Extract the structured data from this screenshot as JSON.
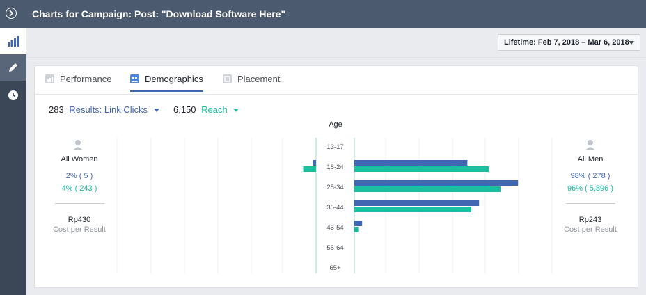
{
  "header": {
    "title": "Charts for Campaign: Post: \"Download Software Here\""
  },
  "sidebar": {
    "items": [
      {
        "icon": "bar-chart-icon"
      },
      {
        "icon": "pencil-icon"
      },
      {
        "icon": "clock-icon"
      }
    ]
  },
  "date_range": {
    "label": "Lifetime: Feb 7, 2018 – Mar 6, 2018"
  },
  "tabs": [
    {
      "label": "Performance",
      "icon": "performance-icon"
    },
    {
      "label": "Demographics",
      "icon": "demographics-icon",
      "selected": true
    },
    {
      "label": "Placement",
      "icon": "placement-icon"
    }
  ],
  "metrics": {
    "results": {
      "value": "283",
      "label": "Results: Link Clicks",
      "color": "#4267b2"
    },
    "reach": {
      "value": "6,150",
      "label": "Reach",
      "color": "#19bf9e"
    }
  },
  "women": {
    "label": "All Women",
    "results_text": "2% ( 5 )",
    "reach_text": "4% ( 243 )",
    "cost_value": "Rp430",
    "cost_label": "Cost per Result"
  },
  "men": {
    "label": "All Men",
    "results_text": "98% ( 278 )",
    "reach_text": "96% ( 5,896 )",
    "cost_value": "Rp243",
    "cost_label": "Cost per Result"
  },
  "chart_data": {
    "type": "bar",
    "title": "Age",
    "categories": [
      "13-17",
      "18-24",
      "25-34",
      "35-44",
      "45-54",
      "55-64",
      "65+"
    ],
    "series": [
      {
        "name": "Results: Link Clicks",
        "color": "#4267b2",
        "women": [
          0,
          1.6,
          0,
          0,
          0,
          0,
          0
        ],
        "men": [
          0,
          58,
          84,
          64,
          4,
          0,
          0
        ]
      },
      {
        "name": "Reach",
        "color": "#19bf9e",
        "women": [
          0,
          6.6,
          0,
          0,
          0,
          0,
          0
        ],
        "men": [
          0,
          69,
          75,
          60,
          2,
          0,
          0
        ]
      }
    ]
  }
}
